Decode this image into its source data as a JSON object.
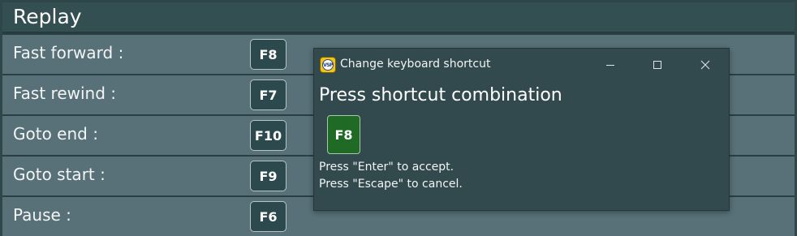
{
  "section": {
    "title": "Replay"
  },
  "rows": [
    {
      "label": "Fast forward :",
      "key": "F8"
    },
    {
      "label": "Fast rewind :",
      "key": "F7"
    },
    {
      "label": "Goto end :",
      "key": "F10"
    },
    {
      "label": "Goto start :",
      "key": "F9"
    },
    {
      "label": "Pause :",
      "key": "F6"
    }
  ],
  "dialog": {
    "title": "Change keyboard shortcut",
    "app_icon_text": "VSP",
    "heading": "Press shortcut combination",
    "captured_key": "F8",
    "instruction_accept": "Press \"Enter\" to accept.",
    "instruction_cancel": "Press \"Escape\" to cancel.",
    "minimize_icon": "minimize-icon",
    "maximize_icon": "maximize-icon",
    "close_icon": "close-icon"
  },
  "colors": {
    "background": "#2f4749",
    "row": "#587078",
    "key_button": "#2c4a4e",
    "captured_key": "#1f6a24",
    "dialog": "#324a4e"
  }
}
